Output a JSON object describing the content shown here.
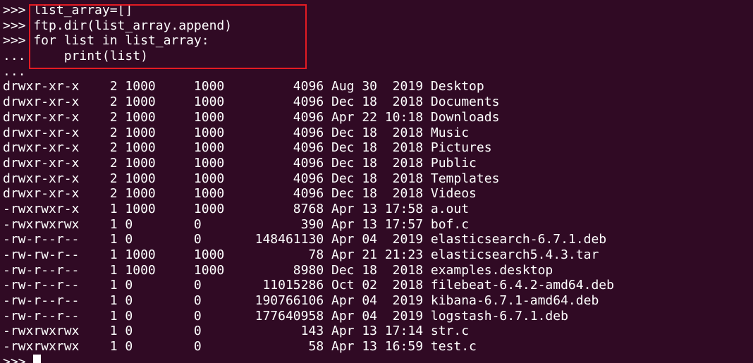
{
  "terminal": {
    "lines": [
      ">>> list_array=[]",
      ">>> ftp.dir(list_array.append)",
      ">>> for list in list_array:",
      "...     print(list)",
      "...",
      "drwxr-xr-x    2 1000     1000         4096 Aug 30  2019 Desktop",
      "drwxr-xr-x    2 1000     1000         4096 Dec 18  2018 Documents",
      "drwxr-xr-x    2 1000     1000         4096 Apr 22 10:18 Downloads",
      "drwxr-xr-x    2 1000     1000         4096 Dec 18  2018 Music",
      "drwxr-xr-x    2 1000     1000         4096 Dec 18  2018 Pictures",
      "drwxr-xr-x    2 1000     1000         4096 Dec 18  2018 Public",
      "drwxr-xr-x    2 1000     1000         4096 Dec 18  2018 Templates",
      "drwxr-xr-x    2 1000     1000         4096 Dec 18  2018 Videos",
      "-rwxrwxr-x    1 1000     1000         8768 Apr 13 17:58 a.out",
      "-rwxrwxrwx    1 0        0             390 Apr 13 17:57 bof.c",
      "-rw-r--r--    1 0        0       148461130 Apr 04  2019 elasticsearch-6.7.1.deb",
      "-rw-rw-r--    1 1000     1000           78 Apr 21 21:23 elasticsearch5.4.3.tar",
      "-rw-r--r--    1 1000     1000         8980 Dec 18  2018 examples.desktop",
      "-rw-r--r--    1 0        0        11015286 Oct 02  2018 filebeat-6.4.2-amd64.deb",
      "-rw-r--r--    1 0        0       190766106 Apr 04  2019 kibana-6.7.1-amd64.deb",
      "-rw-r--r--    1 0        0       177640958 Apr 04  2019 logstash-6.7.1.deb",
      "-rwxrwxrwx    1 0        0             143 Apr 13 17:14 str.c",
      "-rwxrwxrwx    1 0        0              58 Apr 13 16:59 test.c"
    ],
    "final_prompt": ">>> "
  },
  "colors": {
    "background": "#300a24",
    "text": "#ffffff",
    "highlight_border": "#e41b23"
  }
}
